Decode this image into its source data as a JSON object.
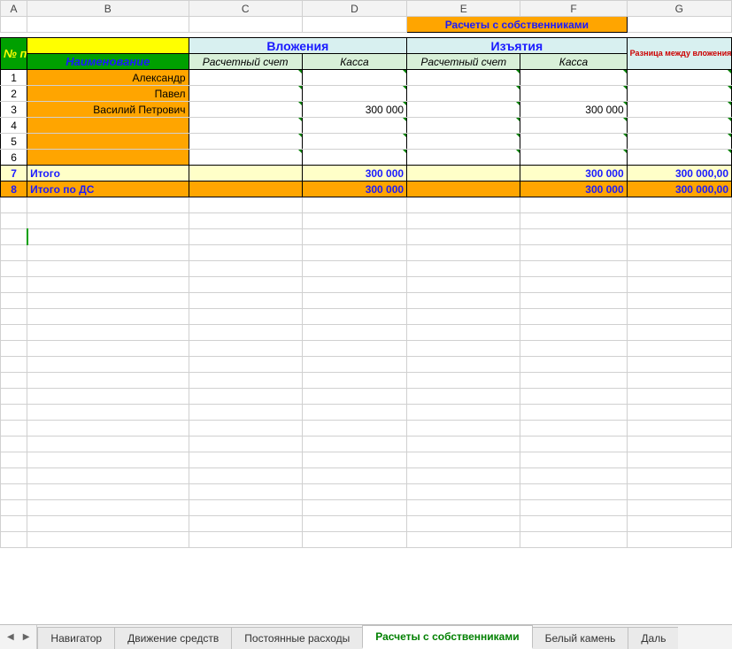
{
  "columns": [
    "A",
    "B",
    "C",
    "D",
    "E",
    "F",
    "G"
  ],
  "title": "Расчеты с собственниками",
  "headers": {
    "np": "№ п/п",
    "naim": "Наименование",
    "vloj": "Вложения",
    "izyat": "Изъятия",
    "raznica": "Разница между вложениями и изъятиями",
    "raschet": "Расчетный счет",
    "kassa": "Касса"
  },
  "rows": [
    {
      "n": "1",
      "name": "Александр",
      "c": "",
      "d": "",
      "e": "",
      "f": "",
      "g": ""
    },
    {
      "n": "2",
      "name": "Павел",
      "c": "",
      "d": "",
      "e": "",
      "f": "",
      "g": ""
    },
    {
      "n": "3",
      "name": "Василий Петрович",
      "c": "",
      "d": "300 000",
      "e": "",
      "f": "300 000",
      "g": ""
    },
    {
      "n": "4",
      "name": "",
      "c": "",
      "d": "",
      "e": "",
      "f": "",
      "g": ""
    },
    {
      "n": "5",
      "name": "",
      "c": "",
      "d": "",
      "e": "",
      "f": "",
      "g": ""
    },
    {
      "n": "6",
      "name": "",
      "c": "",
      "d": "",
      "e": "",
      "f": "",
      "g": ""
    }
  ],
  "itogo": {
    "n": "7",
    "label": "Итого",
    "c": "",
    "d": "300 000",
    "e": "",
    "f": "300 000",
    "g": "300 000,00"
  },
  "itogo_ds": {
    "n": "8",
    "label": "Итого по ДС",
    "c": "",
    "d": "300 000",
    "e": "",
    "f": "300 000",
    "g": "300 000,00"
  },
  "tabs": {
    "items": [
      "Навигатор",
      "Движение средств",
      "Постоянные расходы",
      "Расчеты с собственниками",
      "Белый камень",
      "Даль"
    ],
    "active": 3
  },
  "chart_data": {
    "type": "table",
    "title": "Расчеты с собственниками",
    "columns": [
      "№ п/п",
      "Наименование",
      "Вложения / Расчетный счет",
      "Вложения / Касса",
      "Изъятия / Расчетный счет",
      "Изъятия / Касса",
      "Разница между вложениями и изъятиями"
    ],
    "rows": [
      [
        1,
        "Александр",
        null,
        null,
        null,
        null,
        null
      ],
      [
        2,
        "Павел",
        null,
        null,
        null,
        null,
        null
      ],
      [
        3,
        "Василий Петрович",
        null,
        300000,
        null,
        300000,
        null
      ],
      [
        4,
        "",
        null,
        null,
        null,
        null,
        null
      ],
      [
        5,
        "",
        null,
        null,
        null,
        null,
        null
      ],
      [
        6,
        "",
        null,
        null,
        null,
        null,
        null
      ]
    ],
    "totals": [
      {
        "label": "Итого",
        "values": [
          null,
          300000,
          null,
          300000,
          300000.0
        ]
      },
      {
        "label": "Итого по ДС",
        "values": [
          null,
          300000,
          null,
          300000,
          300000.0
        ]
      }
    ]
  }
}
